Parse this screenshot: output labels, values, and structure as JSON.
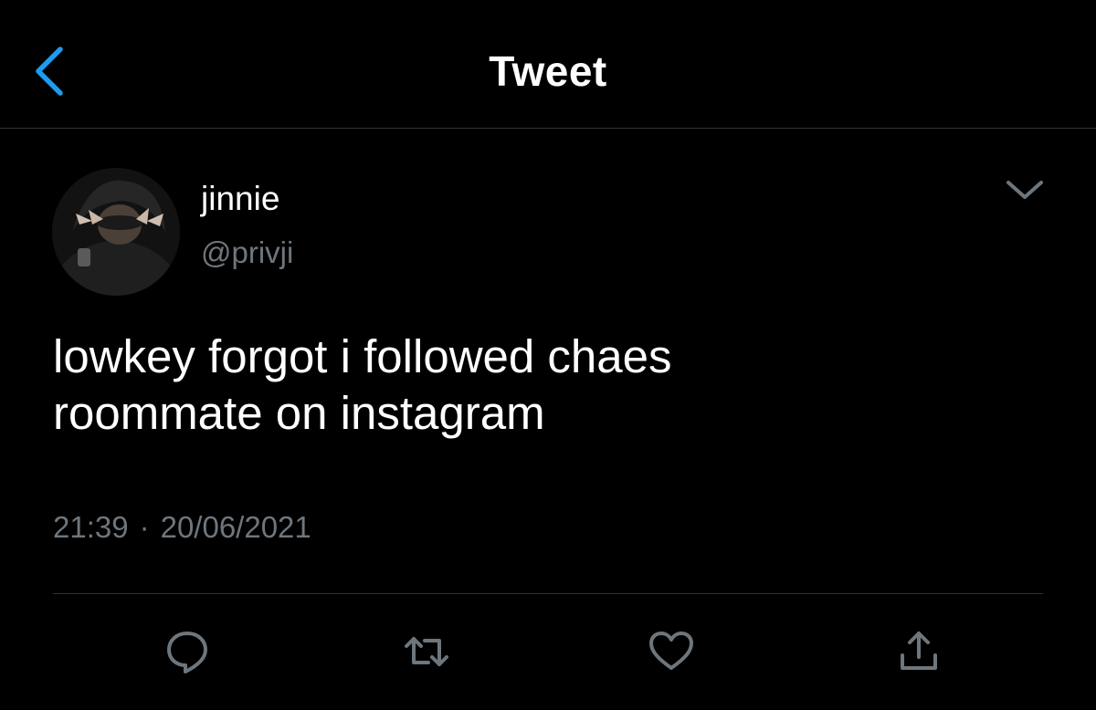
{
  "nav": {
    "title": "Tweet",
    "back_icon": "chevron-left-icon"
  },
  "tweet": {
    "avatar_icon": "profile-photo",
    "display_name": "jinnie",
    "handle": "@privji",
    "more_icon": "chevron-down-icon",
    "text_line1": "lowkey forgot i followed chaes",
    "text_line2": "roommate on instagram",
    "time": "21:39",
    "separator": "·",
    "date": "20/06/2021"
  },
  "actions": [
    {
      "icon": "reply-icon"
    },
    {
      "icon": "retweet-icon"
    },
    {
      "icon": "like-icon"
    },
    {
      "icon": "share-icon"
    }
  ],
  "colors": {
    "background": "#000000",
    "text": "#ffffff",
    "secondary_text": "#6e767d",
    "accent": "#1d9bf0",
    "divider": "#2f3336"
  }
}
